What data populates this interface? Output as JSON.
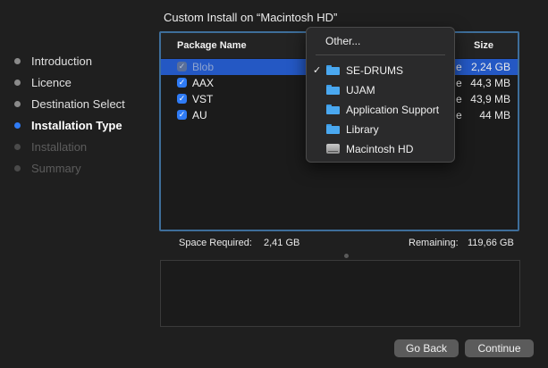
{
  "title": "Custom Install on “Macintosh HD”",
  "steps": [
    {
      "label": "Introduction",
      "state": "done"
    },
    {
      "label": "Licence",
      "state": "done"
    },
    {
      "label": "Destination Select",
      "state": "done"
    },
    {
      "label": "Installation Type",
      "state": "active"
    },
    {
      "label": "Installation",
      "state": "pending"
    },
    {
      "label": "Summary",
      "state": "pending"
    }
  ],
  "table": {
    "col_name": "Package Name",
    "col_size": "Size",
    "rows": [
      {
        "name": "Blob",
        "action_fragment": "e",
        "size": "2,24 GB",
        "checked": true,
        "disabled": true,
        "selected": true
      },
      {
        "name": "AAX",
        "action_fragment": "e",
        "size": "44,3 MB",
        "checked": true,
        "disabled": false,
        "selected": false
      },
      {
        "name": "VST",
        "action_fragment": "e",
        "size": "43,9 MB",
        "checked": true,
        "disabled": false,
        "selected": false
      },
      {
        "name": "AU",
        "action_fragment": "e",
        "size": "44 MB",
        "checked": true,
        "disabled": false,
        "selected": false
      }
    ]
  },
  "space": {
    "required_label": "Space Required:",
    "required_value": "2,41 GB",
    "remaining_label": "Remaining:",
    "remaining_value": "119,66 GB"
  },
  "popup": {
    "other_label": "Other...",
    "items": [
      {
        "label": "SE-DRUMS",
        "icon": "folder-icon",
        "checked": true
      },
      {
        "label": "UJAM",
        "icon": "folder-icon",
        "checked": false
      },
      {
        "label": "Application Support",
        "icon": "folder-icon",
        "checked": false
      },
      {
        "label": "Library",
        "icon": "folder-icon",
        "checked": false
      },
      {
        "label": "Macintosh HD",
        "icon": "hard-disk-icon",
        "checked": false
      }
    ]
  },
  "buttons": {
    "back": "Go Back",
    "continue": "Continue"
  },
  "colors": {
    "accent": "#2f7bf5",
    "selection": "#2458c4",
    "focus_ring": "#3e6e9a",
    "folder": "#4aa8f0"
  }
}
